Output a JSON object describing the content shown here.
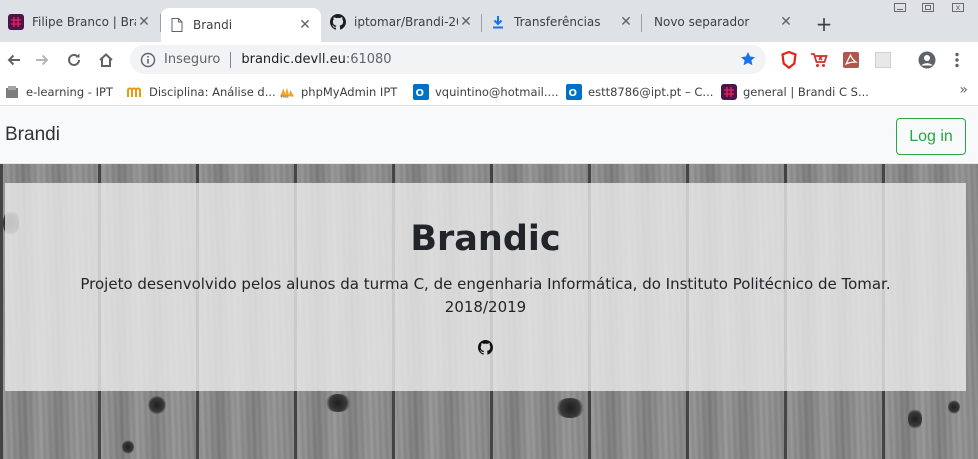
{
  "browser": {
    "tabs": [
      {
        "title": "Filipe Branco | Brar",
        "active": false
      },
      {
        "title": "Brandi",
        "active": true
      },
      {
        "title": "iptomar/Brandi-20",
        "active": false
      },
      {
        "title": "Transferências",
        "active": false
      },
      {
        "title": "Novo separador",
        "active": false
      }
    ],
    "address": {
      "security_label": "Inseguro",
      "host": "brandic.devll.eu",
      "port": ":61080"
    },
    "bookmarks": [
      {
        "label": "e-learning - IPT"
      },
      {
        "label": "Disciplina: Análise d..."
      },
      {
        "label": "phpMyAdmin IPT"
      },
      {
        "label": "vquintino@hotmail...."
      },
      {
        "label": "estt8786@ipt.pt – C..."
      },
      {
        "label": "general | Brandi C S..."
      }
    ]
  },
  "site": {
    "navbar": {
      "brand": "Brandi",
      "login_label": "Log in"
    },
    "jumbotron": {
      "title": "Brandic",
      "lead": "Projeto desenvolvido pelos alunos da turma C, de engenharia Informática, do Instituto Politécnico de Tomar. 2018/2019",
      "icon": "github-icon"
    }
  },
  "colors": {
    "login_accent": "#28a745",
    "tabstrip": "#dee1e6",
    "slack_purple": "#4a154b"
  }
}
